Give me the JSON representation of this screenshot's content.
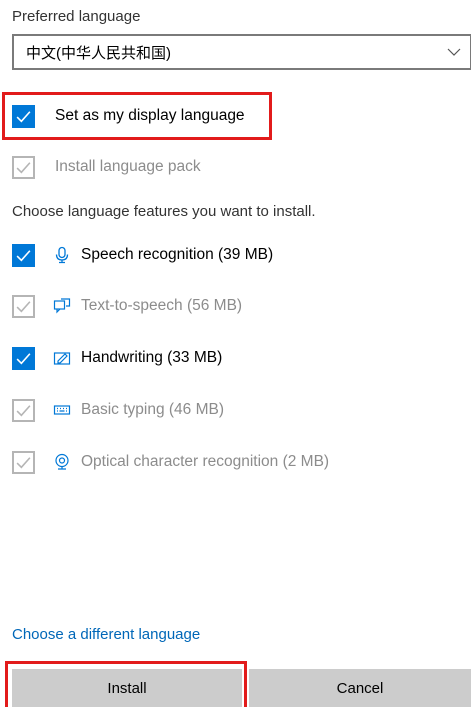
{
  "preferred_language": {
    "label": "Preferred language",
    "selected": "中文(中华人民共和国)"
  },
  "options": {
    "display_language": {
      "label": "Set as my display language",
      "checked": true
    },
    "language_pack": {
      "label": "Install language pack",
      "checked": true,
      "disabled": true
    }
  },
  "features": {
    "heading": "Choose language features you want to install.",
    "items": [
      {
        "label": "Speech recognition (39 MB)",
        "icon": "microphone-icon",
        "checked": true,
        "disabled": false
      },
      {
        "label": "Text-to-speech (56 MB)",
        "icon": "speech-bubble-icon",
        "checked": true,
        "disabled": true
      },
      {
        "label": "Handwriting (33 MB)",
        "icon": "pen-icon",
        "checked": true,
        "disabled": false
      },
      {
        "label": "Basic typing (46 MB)",
        "icon": "keyboard-icon",
        "checked": true,
        "disabled": true
      },
      {
        "label": "Optical character recognition (2 MB)",
        "icon": "webcam-icon",
        "checked": true,
        "disabled": true
      }
    ]
  },
  "footer": {
    "link": "Choose a different language",
    "install": "Install",
    "cancel": "Cancel"
  },
  "colors": {
    "accent": "#0078d7",
    "link": "#0067b8",
    "highlight": "#e21b1b",
    "button_bg": "#cccccc",
    "disabled": "#8c8c8c"
  }
}
